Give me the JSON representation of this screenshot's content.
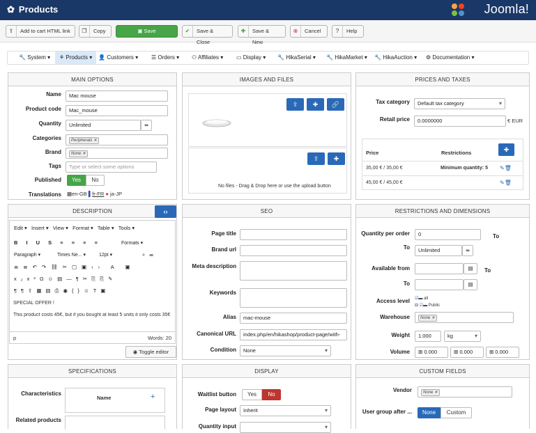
{
  "app": {
    "title": "Products",
    "brand": "Joomla!"
  },
  "toolbar": {
    "add_to_cart": "Add to cart HTML link",
    "copy": "Copy",
    "save": "Save",
    "save_close": "Save & Close",
    "save_new": "Save & New",
    "cancel": "Cancel",
    "help": "Help"
  },
  "menu": [
    "System",
    "Products",
    "Customers",
    "Orders",
    "Affiliates",
    "Display",
    "HikaSerial",
    "HikaMarket",
    "HikaAuction",
    "Documentation"
  ],
  "main_options": {
    "header": "MAIN OPTIONS",
    "name_label": "Name",
    "name": "Mac mouse",
    "code_label": "Product code",
    "code": "Mac_mouse",
    "qty_label": "Quantity",
    "qty": "Unlimited",
    "cat_label": "Categories",
    "cat_tag": "Peripherals",
    "brand_label": "Brand",
    "brand_tag": "None",
    "tags_label": "Tags",
    "tags_placeholder": "Type or select some options",
    "published_label": "Published",
    "yes": "Yes",
    "no": "No",
    "trans_label": "Translations",
    "trans": [
      "en-GB",
      "fr-FR",
      "ja-JP"
    ]
  },
  "images": {
    "header": "IMAGES AND FILES",
    "no_files": "No files - Drag & Drop here or use the upload button"
  },
  "prices": {
    "header": "PRICES AND TAXES",
    "tax_label": "Tax category",
    "tax": "Default tax category",
    "retail_label": "Retail price",
    "retail": "0.0000000",
    "currency": "€ EUR",
    "col_price": "Price",
    "col_restr": "Restrictions",
    "rows": [
      {
        "price": "35,00 € / 35,00 €",
        "restr": "Minimum quantity: 5"
      },
      {
        "price": "45,00 € / 45,00 €",
        "restr": ""
      }
    ]
  },
  "description": {
    "header": "DESCRIPTION",
    "menus": [
      "Edit",
      "Insert",
      "View",
      "Format",
      "Table",
      "Tools"
    ],
    "formats": "Formats",
    "paragraph": "Paragraph",
    "font": "Times Ne...",
    "size": "12pt",
    "line1": "SPECIAL OFFER !",
    "line2": "This product costs 45€, but if you bought at least 5 units it only costs 35€",
    "path": "p",
    "words": "Words: 20",
    "toggle": "Toggle editor"
  },
  "seo": {
    "header": "SEO",
    "page_title": "Page title",
    "url": "Brand url",
    "meta": "Meta description",
    "keywords": "Keywords",
    "alias_label": "Alias",
    "alias": "mac-mouse",
    "canon_label": "Canonical URL",
    "canon": "index.php/en/hikashop/product-page/with-",
    "cond_label": "Condition",
    "cond": "None"
  },
  "restrictions": {
    "header": "RESTRICTIONS AND DIMENSIONS",
    "qpo_label": "Quantity per order",
    "qpo": "0",
    "to": "To",
    "unlimited": "Unlimited",
    "avail_label": "Available from",
    "access_label": "Access level",
    "all": "all",
    "public": "Public",
    "wh_label": "Warehouse",
    "wh": "None",
    "weight_label": "Weight",
    "weight": "1.000",
    "weight_unit": "kg",
    "vol_label": "Volume",
    "vol": "0.000"
  },
  "specs": {
    "header": "SPECIFICATIONS",
    "char_label": "Characteristics",
    "name_col": "Name",
    "related": "Related products"
  },
  "display": {
    "header": "DISPLAY",
    "waitlist": "Waitlist button",
    "yes": "Yes",
    "no": "No",
    "layout_label": "Page layout",
    "layout": "Inherit",
    "qty_input": "Quantity input"
  },
  "custom": {
    "header": "CUSTOM FIELDS",
    "vendor_label": "Vendor",
    "vendor": "None",
    "ug_label": "User group after ...",
    "none": "None",
    "custom": "Custom"
  }
}
